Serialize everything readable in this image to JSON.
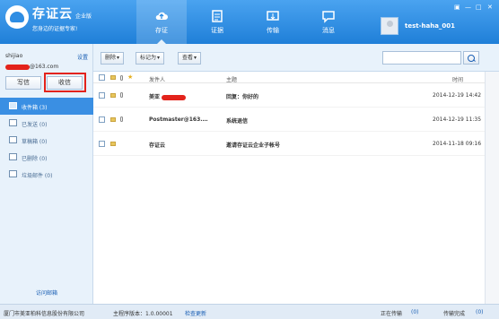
{
  "app": {
    "brand_name": "存证云",
    "brand_edition": "企业版",
    "slogan": "您身边的证据专家!"
  },
  "nav": [
    {
      "label": "存证",
      "icon": "cloud-icon",
      "active": true
    },
    {
      "label": "证据",
      "icon": "document-icon"
    },
    {
      "label": "传输",
      "icon": "transfer-icon"
    },
    {
      "label": "消息",
      "icon": "message-icon"
    }
  ],
  "user": {
    "name": "test-haha_001"
  },
  "account": {
    "name": "shijiao",
    "email_suffix": "@163.com",
    "settings_label": "设置"
  },
  "actions": {
    "write": "写信",
    "receive": "收信"
  },
  "folders": [
    {
      "label": "收件箱 (3)",
      "icon": "inbox-icon",
      "active": true
    },
    {
      "label": "已发送 (0)",
      "icon": "sent-icon"
    },
    {
      "label": "草稿箱 (0)",
      "icon": "drafts-icon"
    },
    {
      "label": "已删除 (0)",
      "icon": "trash-icon"
    },
    {
      "label": "垃圾邮件 (0)",
      "icon": "spam-icon"
    }
  ],
  "access_link": "访问邮箱",
  "toolbar": {
    "delete": "删除",
    "mark_as": "标记为",
    "view": "查看"
  },
  "list_header": {
    "sender": "发件人",
    "subject": "主题",
    "time": "时间"
  },
  "emails": [
    {
      "sender": "美亚",
      "subject": "回复：你好的",
      "time": "2014-12-19 14:42",
      "attachment": true
    },
    {
      "sender": "Postmaster@163.…",
      "subject": "系统退信",
      "time": "2014-12-19 11:35",
      "attachment": true
    },
    {
      "sender": "存证云",
      "subject": "邀请存证云企业子帐号",
      "time": "2014-11-18 09:16",
      "attachment": false
    }
  ],
  "status": {
    "company": "厦门市美亚柏科信息股份有限公司",
    "version": "主程序版本：1.0.00001",
    "check_update": "检查更新",
    "uploading": "正在传输",
    "upload_count": "(0)",
    "done": "传输完成",
    "done_count": "(0)"
  }
}
